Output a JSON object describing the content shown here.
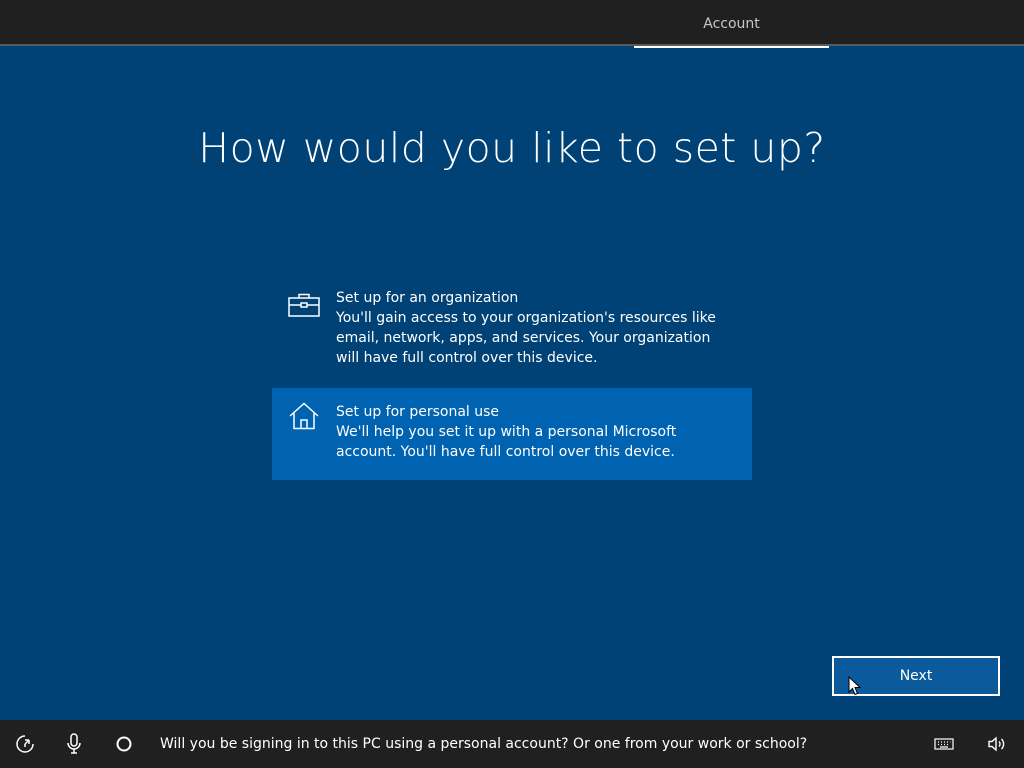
{
  "header": {
    "tab_label": "Account"
  },
  "main": {
    "heading": "How would you like to set up?",
    "options": [
      {
        "icon": "briefcase-icon",
        "title": "Set up for an organization",
        "description": "You'll gain access to your organization's resources like email, network, apps, and services. Your organization will have full control over this device.",
        "selected": false
      },
      {
        "icon": "home-icon",
        "title": "Set up for personal use",
        "description": "We'll help you set it up with a personal Microsoft account. You'll have full control over this device.",
        "selected": true
      }
    ],
    "next_label": "Next"
  },
  "footer": {
    "icons": [
      "ease-of-access-icon",
      "microphone-icon",
      "cortana-icon",
      "keyboard-icon",
      "volume-icon"
    ],
    "prompt": "Will you be signing in to this PC using a personal account? Or one from your work or school?"
  },
  "colors": {
    "background": "#004275",
    "selected_option": "#0063b1",
    "bars": "#202020"
  }
}
